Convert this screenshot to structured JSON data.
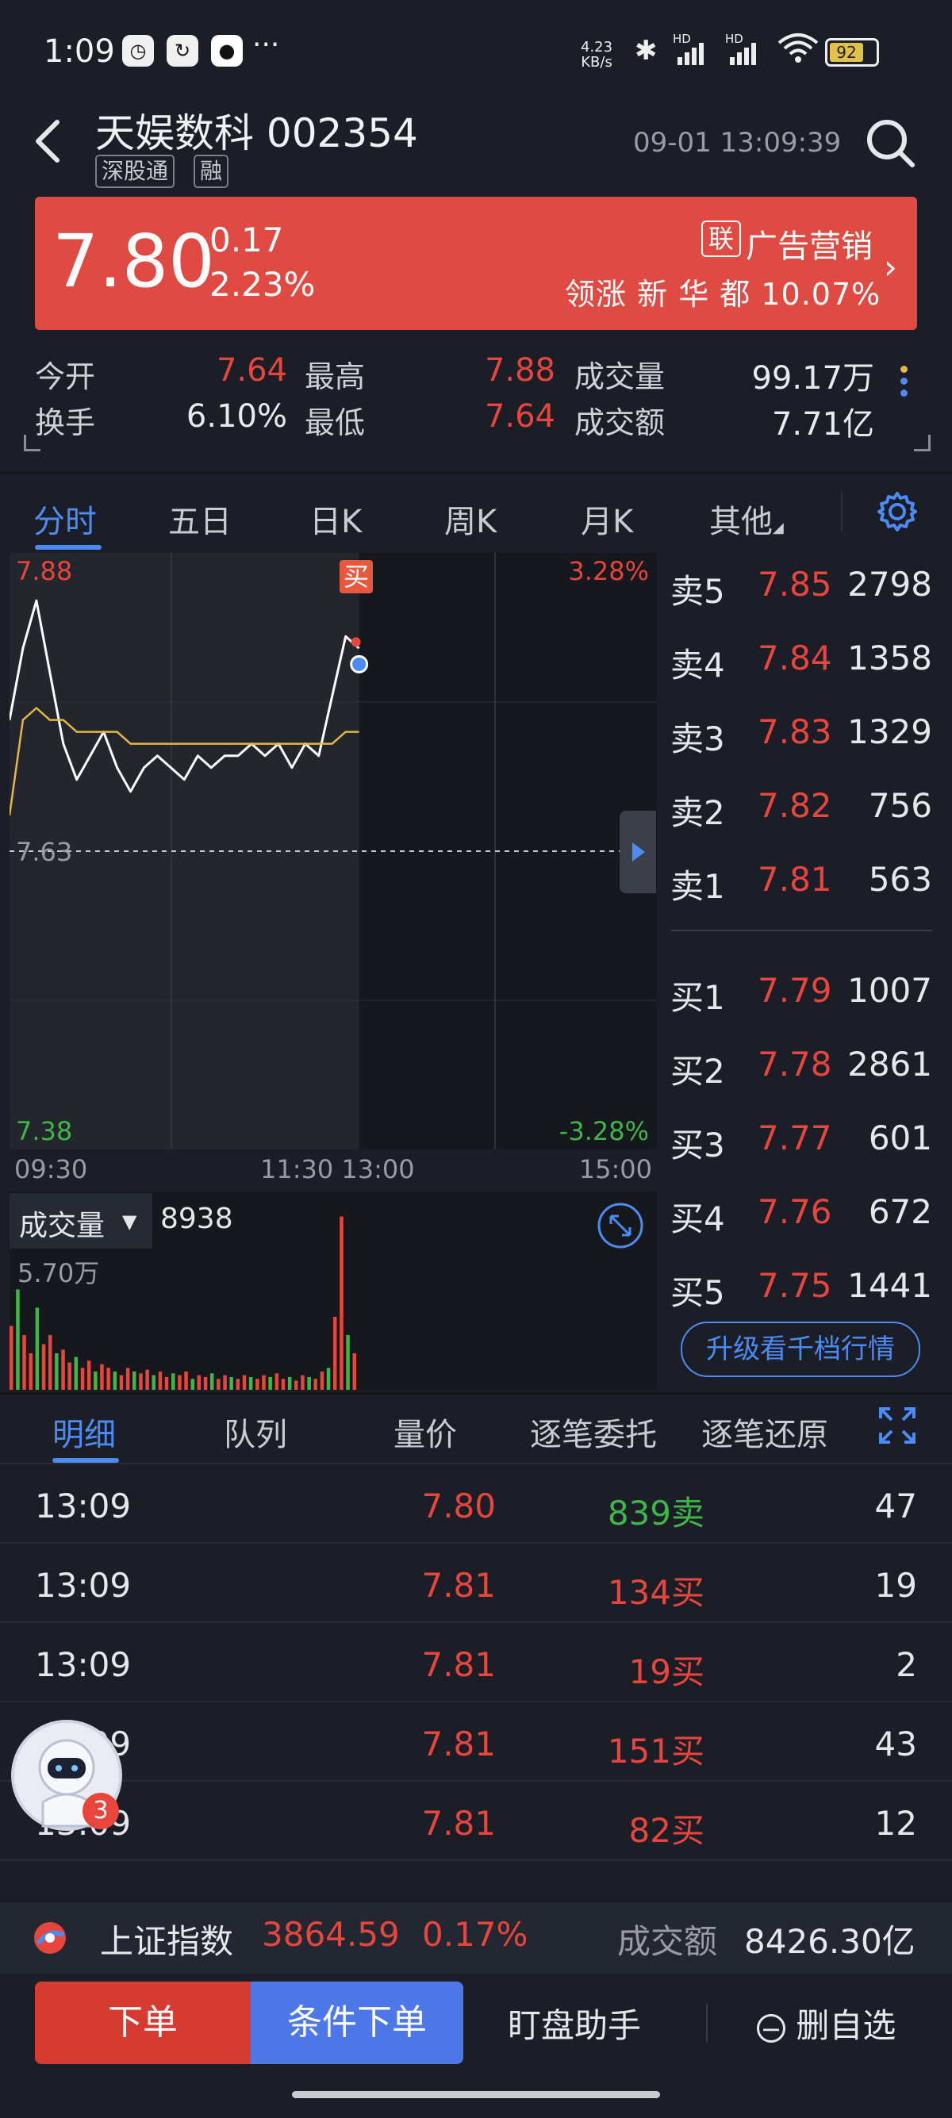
{
  "status_bar": {
    "time": "1:09",
    "net_speed_value": "4.23",
    "net_speed_unit": "KB/s",
    "signal_label_1": "HD",
    "signal_label_2": "HD",
    "wifi_level": "6",
    "battery": "92"
  },
  "header": {
    "stock_name": "天娱数科",
    "stock_code": "002354",
    "tags": [
      "深股通",
      "融"
    ],
    "datetime": "09-01 13:09:39"
  },
  "price_banner": {
    "price": "7.80",
    "change": "0.17",
    "change_pct": "2.23%",
    "sector_badge": "联",
    "sector_name": "广告营销",
    "leader_label": "领涨",
    "leader_name": "新 华 都",
    "leader_pct": "10.07%"
  },
  "stats": [
    {
      "label": "今开",
      "value": "7.64",
      "color": "#e8453c"
    },
    {
      "label": "最高",
      "value": "7.88",
      "color": "#e8453c"
    },
    {
      "label": "成交量",
      "value": "99.17万",
      "color": "#e9eaee"
    },
    {
      "label": "换手",
      "value": "6.10%",
      "color": "#e9eaee"
    },
    {
      "label": "最低",
      "value": "7.64",
      "color": "#e8453c"
    },
    {
      "label": "成交额",
      "value": "7.71亿",
      "color": "#e9eaee"
    }
  ],
  "kline_tabs": [
    "分时",
    "五日",
    "日K",
    "周K",
    "月K",
    "其他"
  ],
  "chart": {
    "price_high": "7.88",
    "pct_high": "3.28%",
    "price_mid": "7.63",
    "price_low": "7.38",
    "pct_low": "-3.28%",
    "buy_marker": "买",
    "time_labels": [
      "09:30",
      "11:30 13:00",
      "15:00"
    ],
    "colors": {
      "price_line": "#ffffff",
      "avg_line": "#e3b646",
      "accent": "#4d8bf4",
      "up": "#e8453c",
      "down": "#3fb54a"
    }
  },
  "chart_data": {
    "type": "line",
    "title": "",
    "ylim": [
      7.38,
      7.88
    ],
    "y_ref": 7.63,
    "xlabel": "",
    "ylabel": "",
    "x_ticks": [
      "09:30",
      "11:30 13:00",
      "15:00"
    ],
    "series": [
      {
        "values": [
          7.74,
          7.8,
          7.84,
          7.78,
          7.72,
          7.69,
          7.71,
          7.73,
          7.7,
          7.68,
          7.7,
          7.71,
          7.7,
          7.69,
          7.71,
          7.7,
          7.71,
          7.71,
          7.72,
          7.71,
          7.72,
          7.7,
          7.72,
          7.71,
          7.76,
          7.81,
          7.8
        ]
      },
      {
        "values": [
          7.66,
          7.74,
          7.75,
          7.74,
          7.74,
          7.73,
          7.73,
          7.73,
          7.73,
          7.72,
          7.72,
          7.72,
          7.72,
          7.72,
          7.72,
          7.72,
          7.72,
          7.72,
          7.72,
          7.72,
          7.72,
          7.72,
          7.72,
          7.72,
          7.72,
          7.73,
          7.73
        ]
      }
    ]
  },
  "volume": {
    "label": "成交量",
    "value": "8938",
    "max_label": "5.70万",
    "bars": [
      0.35,
      0.55,
      0.3,
      0.2,
      0.45,
      0.25,
      0.3,
      0.2,
      0.22,
      0.15,
      0.18,
      0.12,
      0.16,
      0.1,
      0.14,
      0.12,
      0.1,
      0.08,
      0.12,
      0.1,
      0.09,
      0.11,
      0.08,
      0.1,
      0.07,
      0.09,
      0.08,
      0.1,
      0.06,
      0.08,
      0.07,
      0.09,
      0.06,
      0.08,
      0.07,
      0.06,
      0.08,
      0.07,
      0.06,
      0.08,
      0.07,
      0.09,
      0.06,
      0.07,
      0.05,
      0.08,
      0.07,
      0.06,
      0.1,
      0.12,
      0.4,
      0.95,
      0.3,
      0.2
    ]
  },
  "order_book": {
    "asks": [
      {
        "label": "卖5",
        "price": "7.85",
        "vol": "2798"
      },
      {
        "label": "卖4",
        "price": "7.84",
        "vol": "1358"
      },
      {
        "label": "卖3",
        "price": "7.83",
        "vol": "1329"
      },
      {
        "label": "卖2",
        "price": "7.82",
        "vol": "756"
      },
      {
        "label": "卖1",
        "price": "7.81",
        "vol": "563"
      }
    ],
    "bids": [
      {
        "label": "买1",
        "price": "7.79",
        "vol": "1007"
      },
      {
        "label": "买2",
        "price": "7.78",
        "vol": "2861"
      },
      {
        "label": "买3",
        "price": "7.77",
        "vol": "601"
      },
      {
        "label": "买4",
        "price": "7.76",
        "vol": "672"
      },
      {
        "label": "买5",
        "price": "7.75",
        "vol": "1441"
      }
    ],
    "upgrade_label": "升级看千档行情"
  },
  "detail_tabs": [
    "明细",
    "队列",
    "量价",
    "逐笔委托",
    "逐笔还原"
  ],
  "trades": [
    {
      "time": "13:09",
      "price": "7.80",
      "vol": "839卖",
      "side": "sell",
      "count": "47"
    },
    {
      "time": "13:09",
      "price": "7.81",
      "vol": "134买",
      "side": "buy",
      "count": "19"
    },
    {
      "time": "13:09",
      "price": "7.81",
      "vol": "19买",
      "side": "buy",
      "count": "2"
    },
    {
      "time": "13:09",
      "price": "7.81",
      "vol": "151买",
      "side": "buy",
      "count": "43"
    },
    {
      "time": "13:09",
      "price": "7.81",
      "vol": "82买",
      "side": "buy",
      "count": "12"
    }
  ],
  "assistant": {
    "badge": "3"
  },
  "index_ticker": {
    "name": "上证指数",
    "value": "3864.59",
    "pct": "0.17%",
    "amount_label": "成交额",
    "amount_value": "8426.30亿"
  },
  "actions": {
    "order": "下单",
    "conditional_order": "条件下单",
    "monitor": "盯盘助手",
    "remove_favorite": "删自选"
  }
}
